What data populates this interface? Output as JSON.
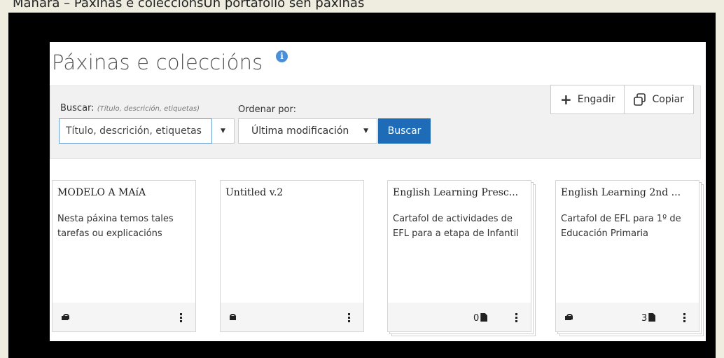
{
  "top_fragment": "Mahara  –  Páxinas  e colecciónsUn  portafolio  sen  páxinas",
  "page": {
    "title": "Páxinas e coleccións",
    "info_icon": "info-icon"
  },
  "search": {
    "label": "Buscar:",
    "hint": "(Título, descrición, etiquetas)",
    "placeholder": "Título, descrición, etiquetas",
    "filter_caret": "▼",
    "order_label": "Ordenar por:",
    "order_value": "Última modificación",
    "order_caret": "▼",
    "submit_label": "Buscar"
  },
  "actions": {
    "add_label": "Engadir",
    "copy_label": "Copiar"
  },
  "cards": [
    {
      "title": "MODELO A MAíA",
      "description": "Nesta páxina temos tales tarefas ou explicacións",
      "locked": false,
      "count": ""
    },
    {
      "title": "Untitled v.2",
      "description": "",
      "locked": true,
      "count": ""
    },
    {
      "title": "English Learning Presc...",
      "description": "Cartafol de actividades de EFL para a etapa de Infantil",
      "locked": null,
      "count": "0"
    },
    {
      "title": "English Learning 2nd ...",
      "description": "Cartafol de EFL para 1º de Educación Primaria",
      "locked": false,
      "count": "3"
    }
  ]
}
